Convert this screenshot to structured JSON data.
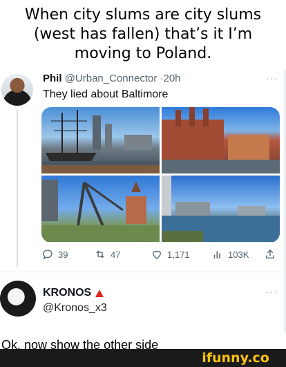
{
  "caption": "When city slums are city slums (west has fallen) that’s it I’m moving to Poland.",
  "tweet": {
    "name": "Phil",
    "handle": "@Urban_Connector",
    "separator": "·",
    "time": "20h",
    "more": "···",
    "text": "They lied about Baltimore",
    "actions": {
      "replies": "39",
      "retweets": "47",
      "likes": "1,171",
      "views": "103K"
    }
  },
  "reply": {
    "name": "KRONOS",
    "handle": "@Kronos_x3",
    "more": "···",
    "text": "Ok, now show the other side"
  },
  "watermark": "ifunny.co",
  "colors": {
    "accent_badge": "#e0241b",
    "watermark": "#fdc30a",
    "muted": "#536471"
  }
}
